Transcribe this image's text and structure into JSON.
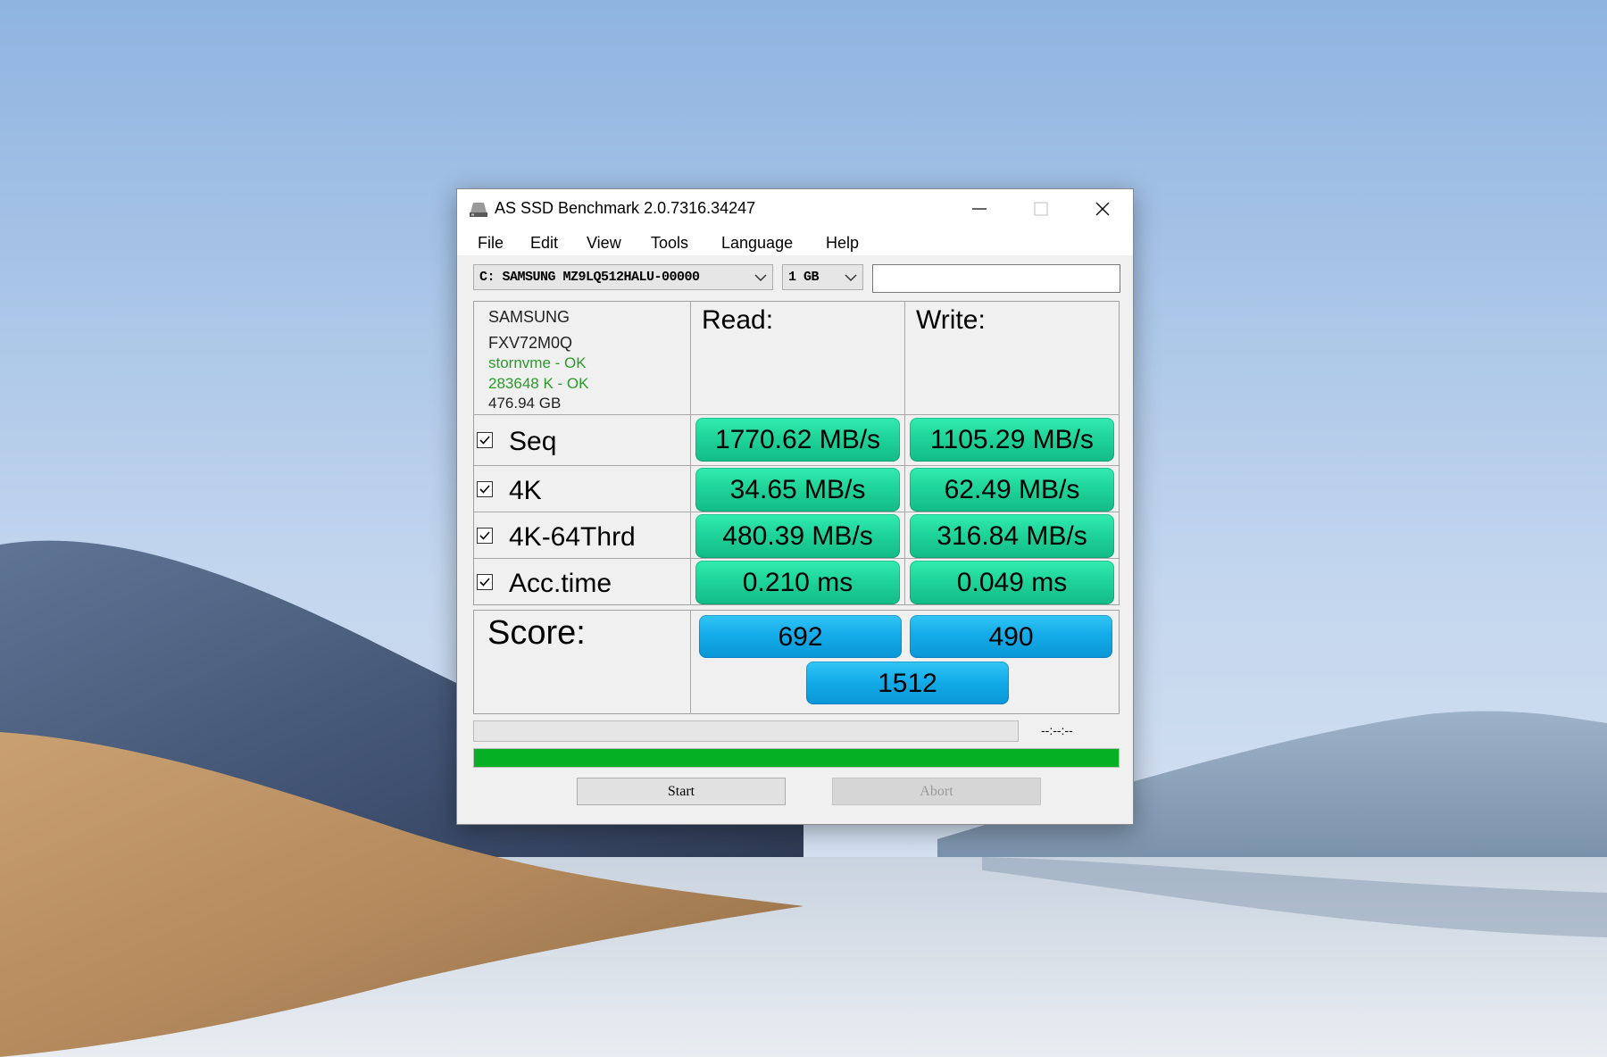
{
  "window": {
    "title": "AS SSD Benchmark 2.0.7316.34247"
  },
  "menu": [
    "File",
    "Edit",
    "View",
    "Tools",
    "Language",
    "Help"
  ],
  "selectors": {
    "drive": "C: SAMSUNG MZ9LQ512HALU-00000",
    "size": "1 GB",
    "extra_field": ""
  },
  "drive_info": {
    "name": "SAMSUNG",
    "firmware": "FXV72M0Q",
    "driver": "stornvme - OK",
    "alignment": "283648 K - OK",
    "capacity": "476.94 GB"
  },
  "columns": {
    "read": "Read:",
    "write": "Write:"
  },
  "tests": [
    {
      "label": "Seq",
      "checked": true,
      "read": "1770.62 MB/s",
      "write": "1105.29 MB/s"
    },
    {
      "label": "4K",
      "checked": true,
      "read": "34.65 MB/s",
      "write": "62.49 MB/s"
    },
    {
      "label": "4K-64Thrd",
      "checked": true,
      "read": "480.39 MB/s",
      "write": "316.84 MB/s"
    },
    {
      "label": "Acc.time",
      "checked": true,
      "read": "0.210 ms",
      "write": "0.049 ms"
    }
  ],
  "score": {
    "label": "Score:",
    "read": "692",
    "write": "490",
    "total": "1512"
  },
  "progress": {
    "time": "--:--:--",
    "fraction": 1.0
  },
  "buttons": {
    "start": "Start",
    "abort": "Abort"
  },
  "colors": {
    "result_green": "#1fd49a",
    "score_blue": "#14acea",
    "progress_green": "#06b025",
    "status_ok": "#2a9a2a"
  }
}
